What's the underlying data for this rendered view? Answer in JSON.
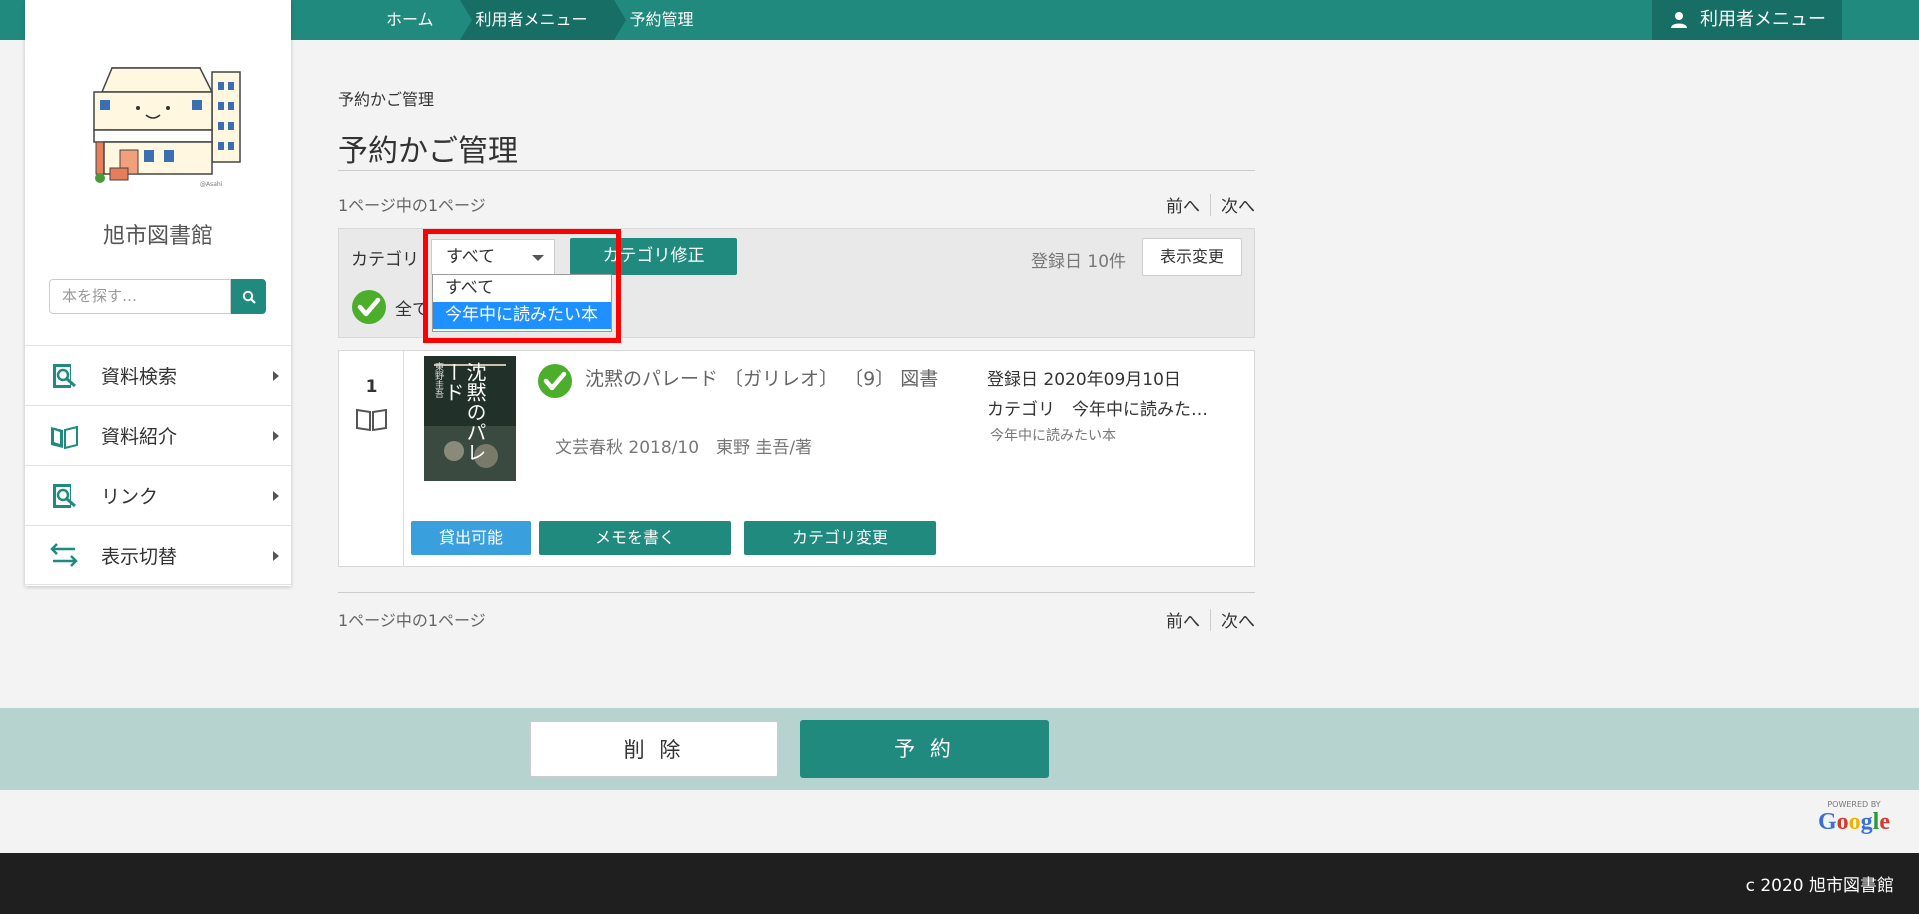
{
  "breadcrumbs": [
    "ホーム",
    "利用者メニュー",
    "予約管理"
  ],
  "user_menu_label": "利用者メニュー",
  "library_name": "旭市図書館",
  "search": {
    "placeholder": "本を探す…"
  },
  "nav": [
    {
      "label": "資料検索",
      "icon": "search-book-icon"
    },
    {
      "label": "資料紹介",
      "icon": "open-book-icon"
    },
    {
      "label": "リンク",
      "icon": "link-search-icon"
    },
    {
      "label": "表示切替",
      "icon": "swap-arrows-icon"
    }
  ],
  "main": {
    "small_breadcrumb": "予約かご管理",
    "title": "予約かご管理",
    "page_info_top": "1ページ中の1ページ",
    "page_info_bottom": "1ページ中の1ページ",
    "prev": "前へ",
    "next": "次へ"
  },
  "category_panel": {
    "label": "カテゴリ",
    "selected": "すべて",
    "options": [
      "すべて",
      "今年中に読みたい本"
    ],
    "highlighted_option": "今年中に読みたい本",
    "fix_button": "カテゴリ修正",
    "sort_info": "登録日 10件",
    "display_button": "表示変更",
    "select_all_label": "全て"
  },
  "items": [
    {
      "number": "1",
      "title": "沈黙のパレード 〔ガリレオ〕 〔9〕 図書",
      "publication": "文芸春秋 2018/10　東野 圭吾∕著",
      "registered": "登録日 2020年09月10日",
      "category": "カテゴリ　今年中に読みた…",
      "category_note": "今年中に読みたい本",
      "cover_text": "沈黙のパレード",
      "cover_author": "東野圭吾",
      "status_button": "貸出可能",
      "memo_button": "メモを書く",
      "category_button": "カテゴリ変更"
    }
  ],
  "actions": {
    "delete": "削 除",
    "reserve": "予 約"
  },
  "powered_by": "POWERED BY",
  "google": "Google",
  "copyright": "c 2020 旭市図書館",
  "colors": {
    "primary": "#208a7e",
    "dark": "#166e64",
    "accent_blue": "#3a9fdd",
    "action_bar": "#b7d3cf",
    "highlight_red": "#ff0000"
  }
}
